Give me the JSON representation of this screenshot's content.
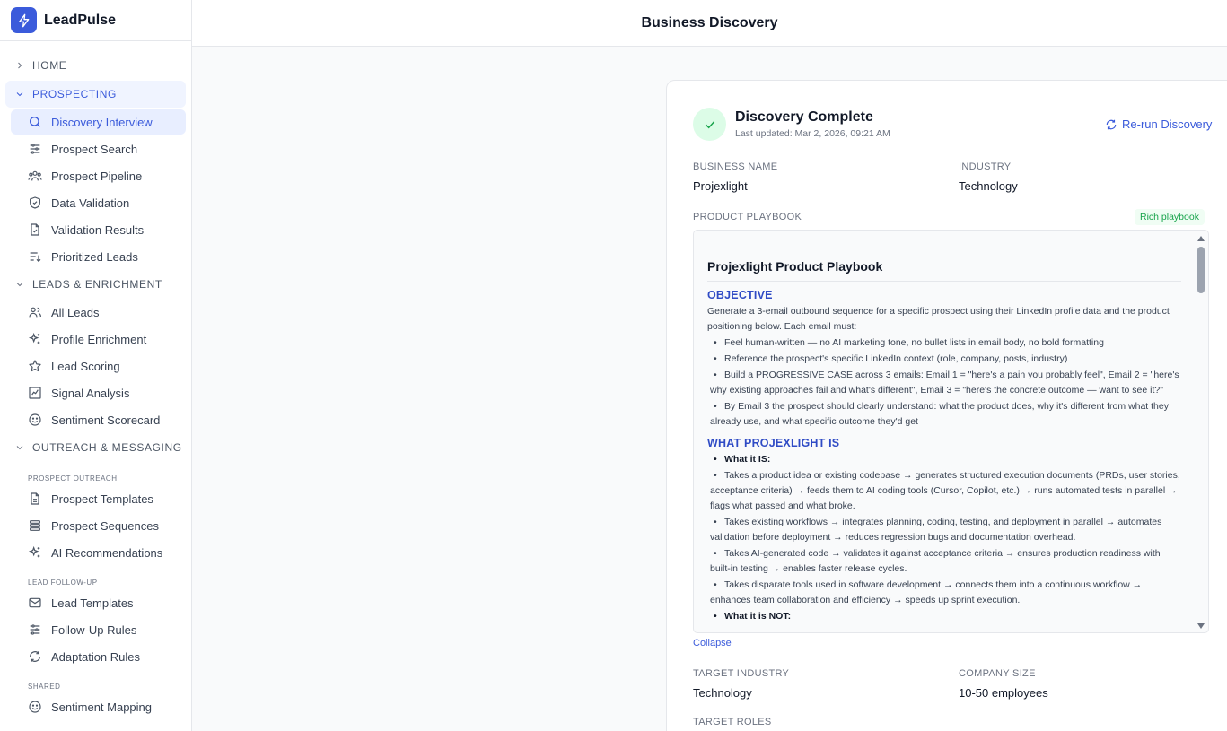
{
  "app": {
    "name": "LeadPulse"
  },
  "header": {
    "title": "Business Discovery"
  },
  "sidebar": {
    "home": "HOME",
    "prospecting": {
      "label": "PROSPECTING",
      "items": [
        "Discovery Interview",
        "Prospect Search",
        "Prospect Pipeline",
        "Data Validation",
        "Validation Results",
        "Prioritized Leads"
      ]
    },
    "leads": {
      "label": "LEADS & ENRICHMENT",
      "items": [
        "All Leads",
        "Profile Enrichment",
        "Lead Scoring",
        "Signal Analysis",
        "Sentiment Scorecard"
      ]
    },
    "outreach": {
      "label": "OUTREACH & MESSAGING",
      "group1": "PROSPECT OUTREACH",
      "group1_items": [
        "Prospect Templates",
        "Prospect Sequences",
        "AI Recommendations"
      ],
      "group2": "LEAD FOLLOW-UP",
      "group2_items": [
        "Lead Templates",
        "Follow-Up Rules",
        "Adaptation Rules"
      ],
      "group3": "SHARED",
      "group3_items": [
        "Sentiment Mapping"
      ]
    }
  },
  "discovery": {
    "status_title": "Discovery Complete",
    "last_updated": "Last updated: Mar 2, 2026, 09:21 AM",
    "rerun_label": "Re-run Discovery",
    "business_name_label": "BUSINESS NAME",
    "business_name": "Projexlight",
    "industry_label": "INDUSTRY",
    "industry": "Technology",
    "playbook_label": "PRODUCT PLAYBOOK",
    "playbook_badge": "Rich playbook",
    "collapse_label": "Collapse",
    "target_industry_label": "TARGET INDUSTRY",
    "target_industry": "Technology",
    "company_size_label": "COMPANY SIZE",
    "company_size": "10-50 employees",
    "target_roles_label": "TARGET ROLES"
  },
  "playbook": {
    "title": "Projexlight Product Playbook",
    "objective_heading": "OBJECTIVE",
    "objective_text": "Generate a 3-email outbound sequence for a specific prospect using their LinkedIn profile data and the product positioning below. Each email must:",
    "objective_bullets": [
      "Feel human-written — no AI marketing tone, no bullet lists in email body, no bold formatting",
      "Reference the prospect's specific LinkedIn context (role, company, posts, industry)",
      "Build a PROGRESSIVE CASE across 3 emails: Email 1 = \"here's a pain you probably feel\", Email 2 = \"here's why existing approaches fail and what's different\", Email 3 = \"here's the concrete outcome — want to see it?\"",
      "By Email 3 the prospect should clearly understand: what the product does, why it's different from what they already use, and what specific outcome they'd get"
    ],
    "what_heading": "WHAT PROJEXLIGHT IS",
    "what_is_label": "What it IS:",
    "what_is_bullets": [
      "Takes a product idea or existing codebase → generates structured execution documents (PRDs, user stories, acceptance criteria) → feeds them to AI coding tools (Cursor, Copilot, etc.) → runs automated tests in parallel → flags what passed and what broke.",
      "Takes existing workflows → integrates planning, coding, testing, and deployment in parallel → automates validation before deployment → reduces regression bugs and documentation overhead.",
      "Takes AI-generated code → validates it against acceptance criteria → ensures production readiness with built-in testing → enables faster release cycles.",
      "Takes disparate tools used in software development → connects them into a continuous workflow → enhances team collaboration and efficiency → speeds up sprint execution."
    ],
    "what_not_label": "What it is NOT:"
  },
  "colors": {
    "accent": "#3b5bdb",
    "success": "#16a34a",
    "success_bg": "#dcfce7"
  }
}
